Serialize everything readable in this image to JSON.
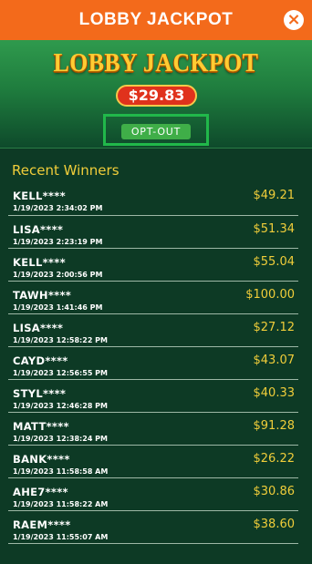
{
  "header": {
    "title": "LOBBY JACKPOT",
    "close_icon": "×"
  },
  "banner": {
    "logo_text": "LOBBY JACKPOT",
    "amount": "$29.83",
    "optout_label": "OPT-OUT"
  },
  "winners": {
    "title": "Recent Winners",
    "items": [
      {
        "name": "KELL****",
        "date": "1/19/2023 2:34:02 PM",
        "amount": "$49.21"
      },
      {
        "name": "LISA****",
        "date": "1/19/2023 2:23:19 PM",
        "amount": "$51.34"
      },
      {
        "name": "KELL****",
        "date": "1/19/2023 2:00:56 PM",
        "amount": "$55.04"
      },
      {
        "name": "TAWH****",
        "date": "1/19/2023 1:41:46 PM",
        "amount": "$100.00"
      },
      {
        "name": "LISA****",
        "date": "1/19/2023 12:58:22 PM",
        "amount": "$27.12"
      },
      {
        "name": "CAYD****",
        "date": "1/19/2023 12:56:55 PM",
        "amount": "$43.07"
      },
      {
        "name": "STYL****",
        "date": "1/19/2023 12:46:28 PM",
        "amount": "$40.33"
      },
      {
        "name": "MATT****",
        "date": "1/19/2023 12:38:24 PM",
        "amount": "$91.28"
      },
      {
        "name": "BANK****",
        "date": "1/19/2023 11:58:58 AM",
        "amount": "$26.22"
      },
      {
        "name": "AHE7****",
        "date": "1/19/2023 11:58:22 AM",
        "amount": "$30.86"
      },
      {
        "name": "RAEM****",
        "date": "1/19/2023 11:55:07 AM",
        "amount": "$38.60"
      }
    ]
  },
  "colors": {
    "header": "#f36a1b",
    "background": "#0d3a25",
    "accent_gold": "#f0cd3a",
    "pill_red": "#e0321c",
    "optout_green": "#3fae48"
  }
}
